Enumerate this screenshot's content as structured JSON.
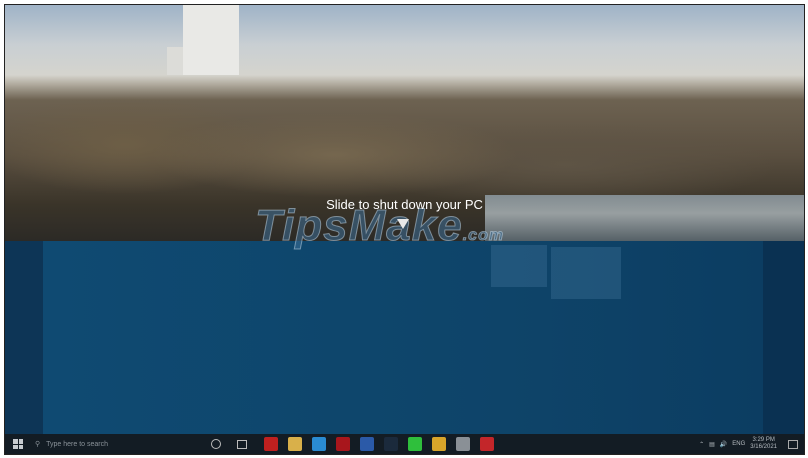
{
  "lock_screen": {
    "slide_text": "Slide to shut down your PC"
  },
  "watermark": {
    "text": "TipsMake",
    "suffix": ".com"
  },
  "taskbar": {
    "search_placeholder": "Type here to search",
    "apps": [
      {
        "name": "opera",
        "color": "#c0201f"
      },
      {
        "name": "file-explorer",
        "color": "#d9b04a"
      },
      {
        "name": "edge",
        "color": "#2a8bd1"
      },
      {
        "name": "red-app",
        "color": "#a8161c"
      },
      {
        "name": "word",
        "color": "#2b5aa8"
      },
      {
        "name": "photoshop",
        "color": "#1b2a3c"
      },
      {
        "name": "line",
        "color": "#2fbf3c"
      },
      {
        "name": "chrome",
        "color": "#d8a52a"
      },
      {
        "name": "unknown-app",
        "color": "#8a9096"
      },
      {
        "name": "red-record",
        "color": "#c3262a"
      }
    ],
    "language": "ENG",
    "time": "3:29 PM",
    "date": "3/16/2021"
  }
}
